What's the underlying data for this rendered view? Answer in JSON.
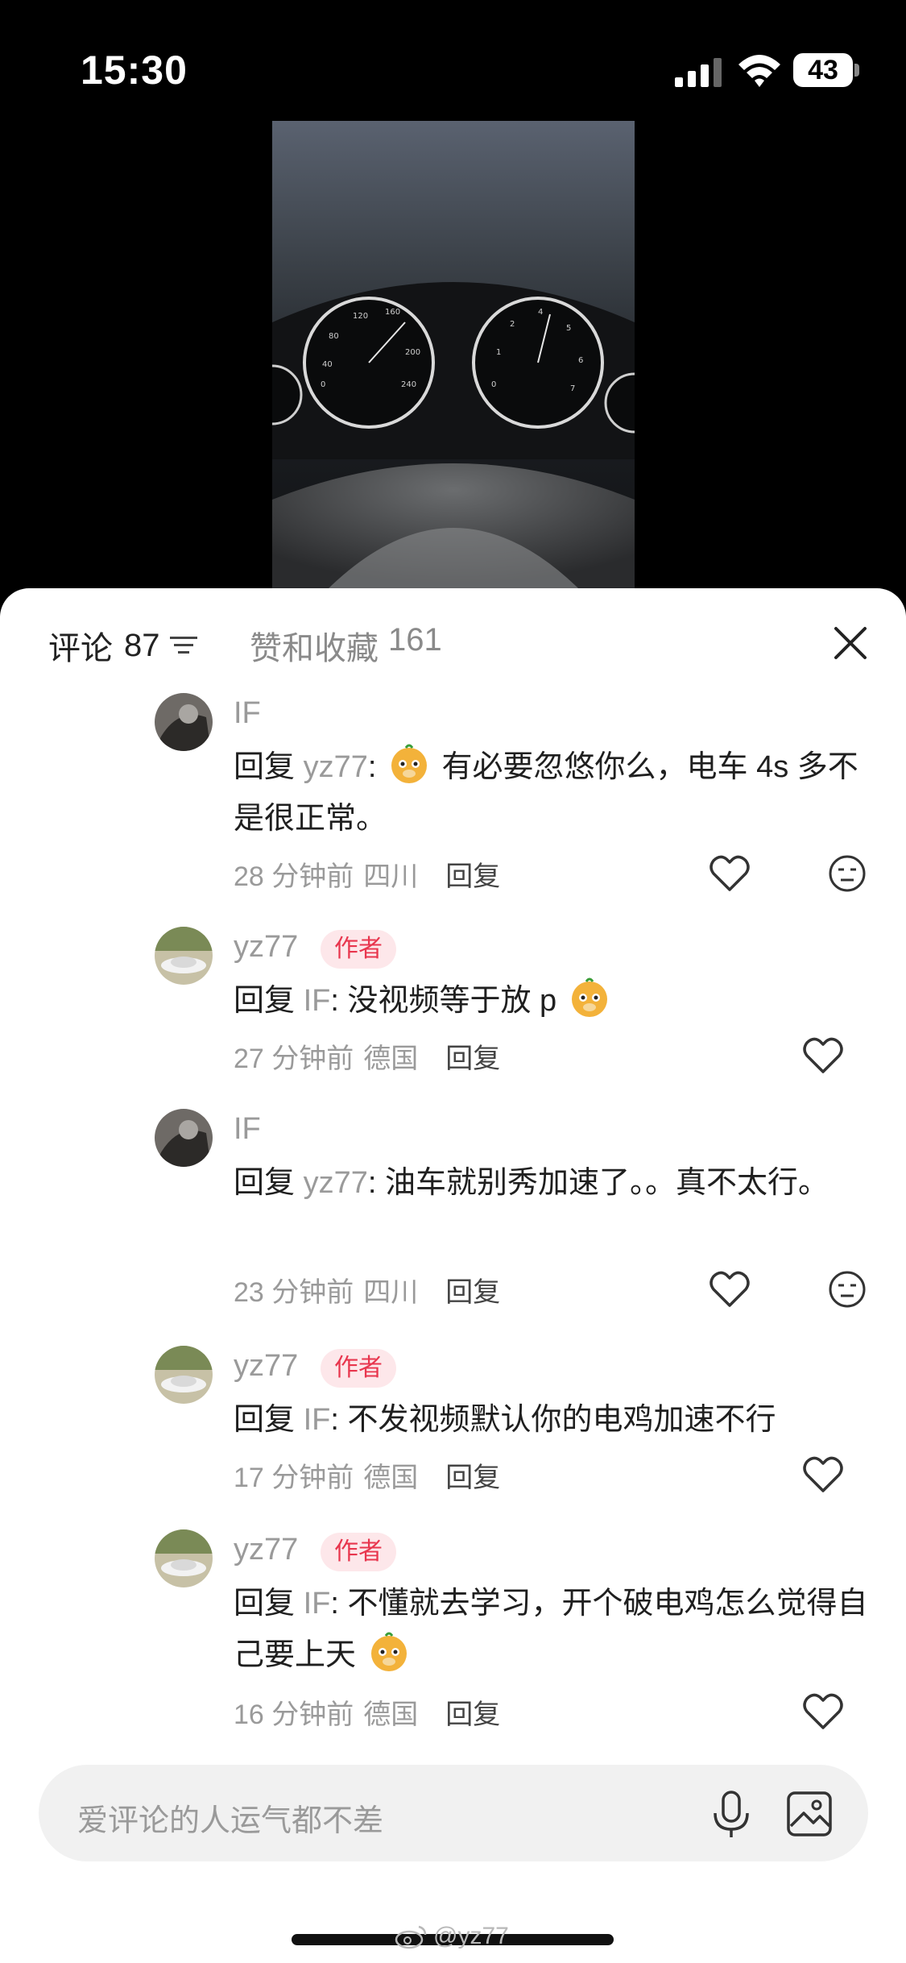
{
  "status_bar": {
    "time": "15:30",
    "battery": "43"
  },
  "tabs": {
    "comments_label": "评论",
    "comments_count": "87",
    "likes_label": "赞和收藏",
    "likes_count": "161"
  },
  "comments": [
    {
      "user": "IF",
      "is_author": false,
      "reply_prefix": "回复",
      "reply_to": "yz77",
      "text_before": "有必要忽悠你么，电车 4s 多不是很正常。",
      "emoji": "meerkat-emoji",
      "time": "28 分钟前",
      "location": "四川",
      "reply_label": "回复"
    },
    {
      "user": "yz77",
      "is_author": true,
      "reply_prefix": "回复",
      "reply_to": "IF",
      "text_before": "没视频等于放 p",
      "emoji": "meerkat-emoji",
      "time": "27 分钟前",
      "location": "德国",
      "reply_label": "回复"
    },
    {
      "user": "IF",
      "is_author": false,
      "reply_prefix": "回复",
      "reply_to": "yz77",
      "text_before": "油车就别秀加速了。。真不太行。",
      "time": "23 分钟前",
      "location": "四川",
      "reply_label": "回复"
    },
    {
      "user": "yz77",
      "is_author": true,
      "reply_prefix": "回复",
      "reply_to": "IF",
      "text_before": "不发视频默认你的电鸡加速不行",
      "time": "17 分钟前",
      "location": "德国",
      "reply_label": "回复"
    },
    {
      "user": "yz77",
      "is_author": true,
      "reply_prefix": "回复",
      "reply_to": "IF",
      "text_before": "不懂就去学习，开个破电鸡怎么觉得自己要上天",
      "emoji": "meerkat-emoji",
      "time": "16 分钟前",
      "location": "德国",
      "reply_label": "回复"
    }
  ],
  "author_badge": "作者",
  "input": {
    "placeholder": "爱评论的人运气都不差"
  },
  "watermark": "@yz77",
  "colors": {
    "badge_text": "#e8364e",
    "badge_bg": "#fde7ea",
    "muted": "#9a9a9a"
  }
}
